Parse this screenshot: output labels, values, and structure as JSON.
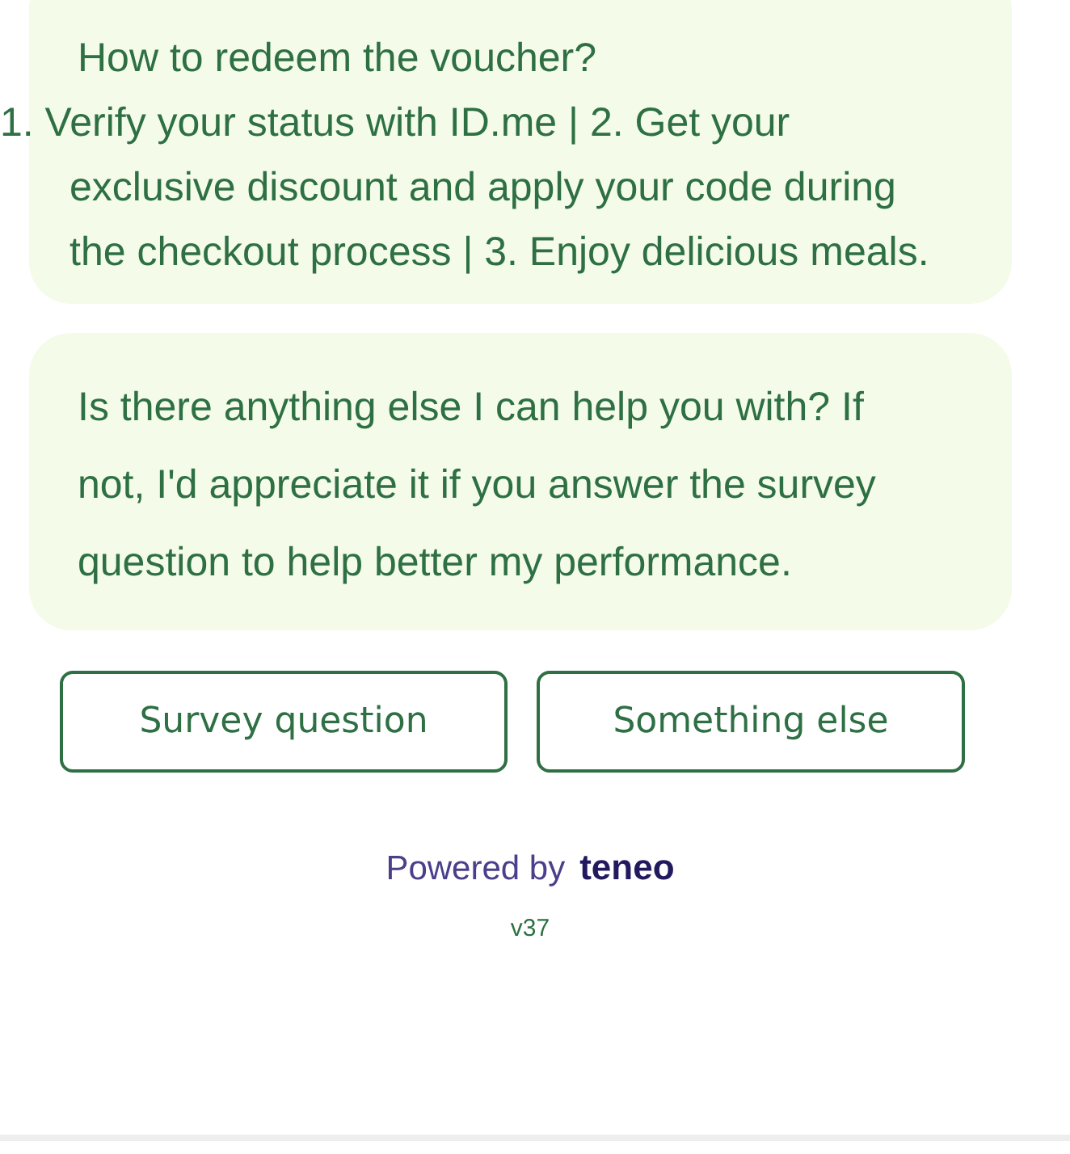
{
  "messages": [
    {
      "title": "How to redeem the voucher?",
      "text": "1. Verify your status with ID.me | 2. Get your exclusive discount and apply your code during the checkout process | 3. Enjoy delicious meals."
    },
    {
      "text": "Is there anything else I can help you with? If not, I'd appreciate it if you answer the survey question to help better my performance."
    }
  ],
  "quick_replies": [
    "Survey question",
    "Something else"
  ],
  "footer": {
    "powered_by": "Powered by",
    "brand": "teneo",
    "version": "v37"
  }
}
